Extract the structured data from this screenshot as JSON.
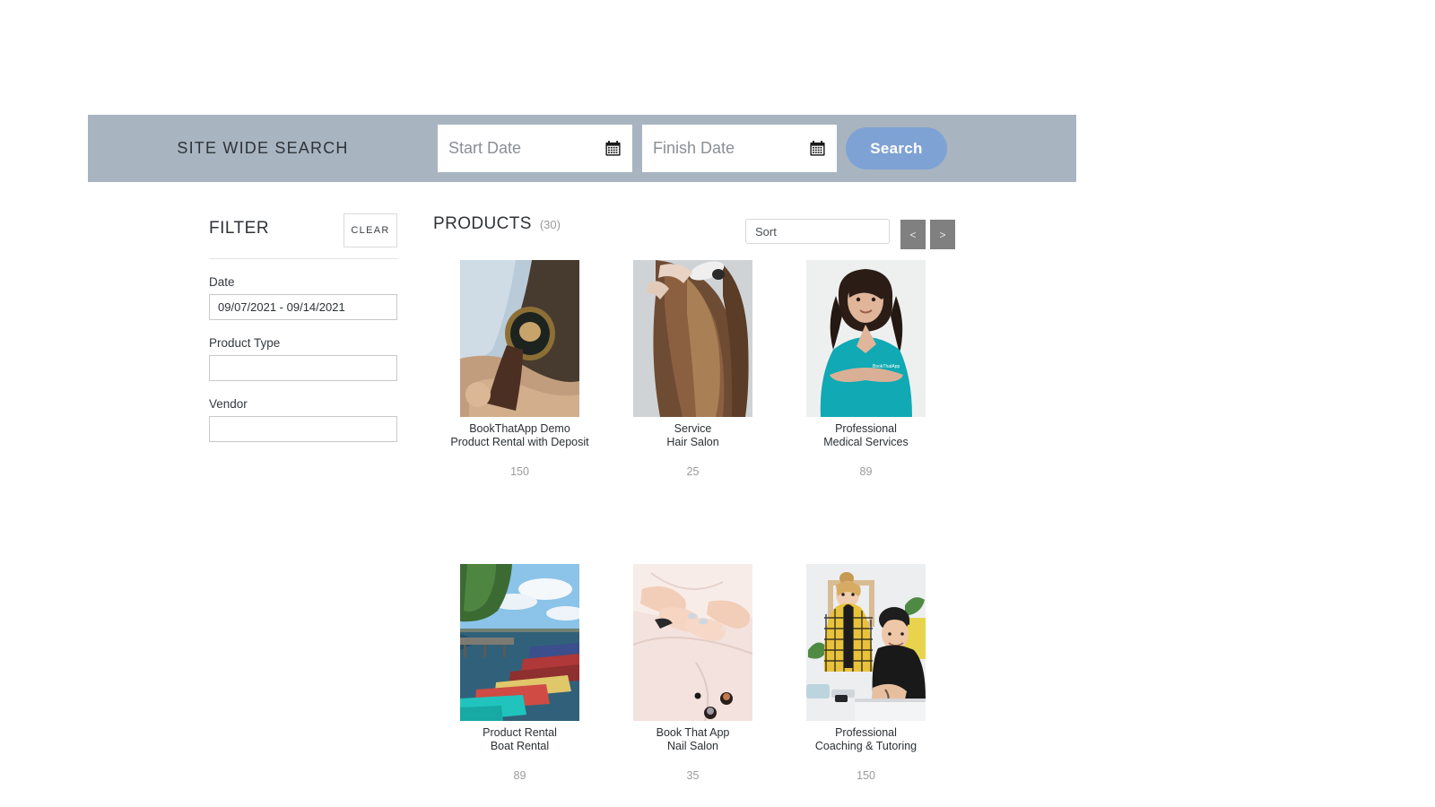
{
  "search_bar": {
    "label": "SITE WIDE SEARCH",
    "start_date": {
      "placeholder": "Start Date",
      "value": "",
      "icon": "calendar-icon"
    },
    "finish_date": {
      "placeholder": "Finish Date",
      "value": "",
      "icon": "calendar-icon"
    },
    "search_button": "Search",
    "bar_color": "#a8b4c0",
    "button_color": "#7ea2d3"
  },
  "filter": {
    "title": "FILTER",
    "clear_label": "CLEAR",
    "fields": [
      {
        "label": "Date",
        "value": "09/07/2021 - 09/14/2021",
        "placeholder": ""
      },
      {
        "label": "Product Type",
        "value": "",
        "placeholder": ""
      },
      {
        "label": "Vendor",
        "value": "",
        "placeholder": ""
      }
    ]
  },
  "products": {
    "title": "PRODUCTS",
    "count": "(30)",
    "sort": {
      "selected": "Sort",
      "options": [
        "Sort"
      ]
    },
    "pagination": {
      "prev": "<",
      "next": ">"
    },
    "items": [
      {
        "vendor": "BookThatApp Demo",
        "name": "Product Rental with Deposit",
        "price": "150",
        "image": "wristwatch-photo"
      },
      {
        "vendor": "Service",
        "name": "Hair Salon",
        "price": "25",
        "image": "hair-styling-photo"
      },
      {
        "vendor": "Professional",
        "name": "Medical Services",
        "price": "89",
        "image": "nurse-portrait-photo"
      },
      {
        "vendor": "Product Rental",
        "name": "Boat Rental",
        "price": "89",
        "image": "pedal-boats-lake-photo"
      },
      {
        "vendor": "Book That App",
        "name": "Nail Salon",
        "price": "35",
        "image": "manicure-photo"
      },
      {
        "vendor": "Professional",
        "name": "Coaching & Tutoring",
        "price": "150",
        "image": "coaching-session-photo"
      }
    ]
  }
}
